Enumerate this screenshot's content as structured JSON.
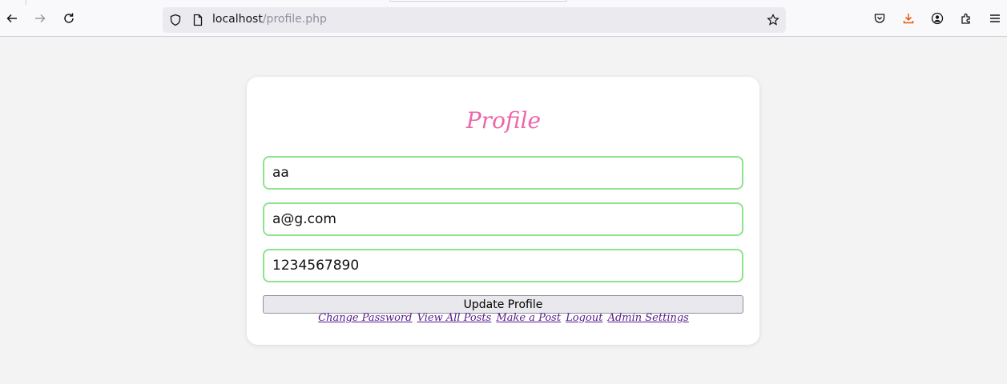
{
  "browser": {
    "url_host": "localhost",
    "url_path": "/profile.php",
    "icons": [
      "back-icon",
      "forward-icon",
      "reload-icon",
      "shield-icon",
      "page-icon",
      "star-icon",
      "pocket-icon",
      "download-icon",
      "account-icon",
      "extensions-icon",
      "menu-icon"
    ],
    "accent_download": "#e8560b"
  },
  "profile": {
    "title": "Profile",
    "username": "aa",
    "email": "a@g.com",
    "phone": "1234567890",
    "update_label": "Update Profile",
    "links": [
      "Change Password",
      "View All Posts",
      "Make a Post",
      "Logout",
      "Admin Settings"
    ]
  },
  "colors": {
    "title": "#ee66aa",
    "field_border": "#8de48d",
    "link": "#551a8b"
  }
}
